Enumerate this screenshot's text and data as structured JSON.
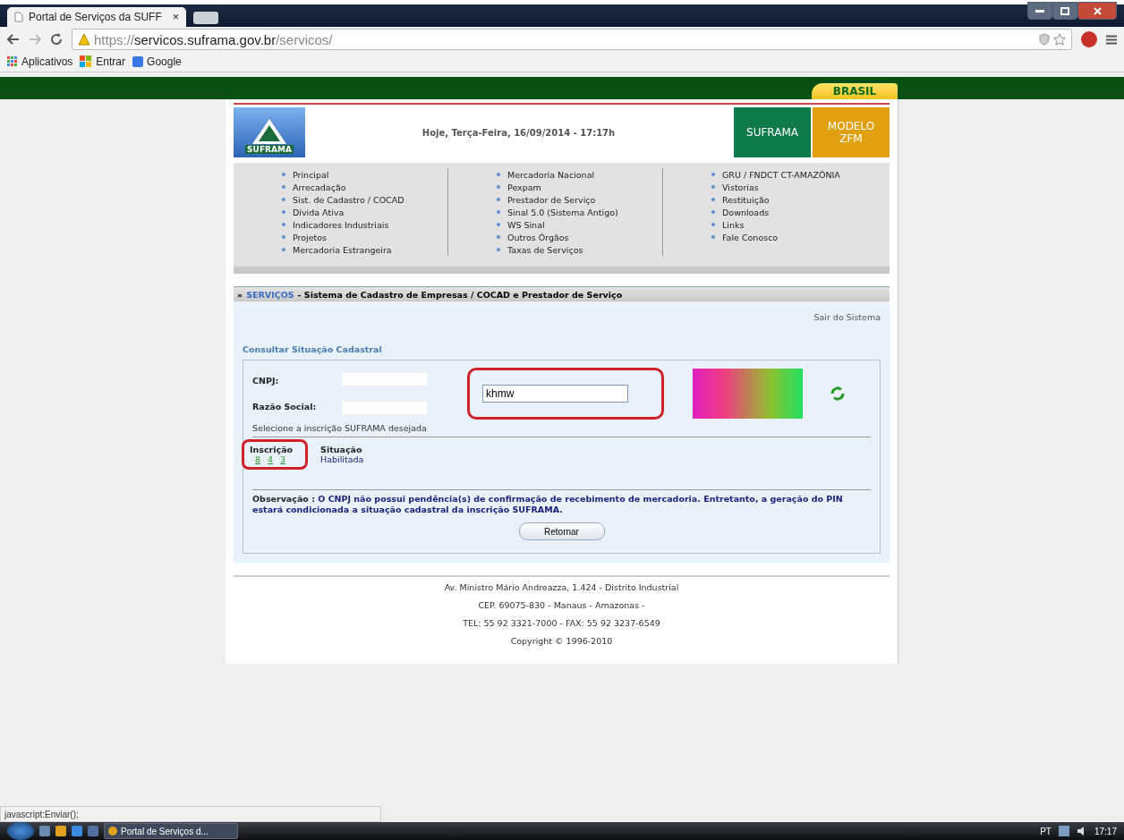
{
  "browser": {
    "tab_title": "Portal de Serviços da SUFF",
    "tab_close": "×",
    "url_scheme": "https://",
    "url_host": "servicos.suframa.gov.br",
    "url_path": "/servicos/",
    "bookmarks": [
      {
        "label": "Aplicativos",
        "kind": "apps"
      },
      {
        "label": "Entrar",
        "kind": "windows"
      },
      {
        "label": "Google",
        "kind": "google"
      }
    ],
    "status_text": "javascript:Enviar();"
  },
  "header": {
    "brasil": "BRASIL",
    "logo_text": "SUFRAMA",
    "date": "Hoje, Terça-Feira, 16/09/2014 - 17:17h",
    "buttons": [
      {
        "label": "SUFRAMA",
        "color": "#0f7a4a"
      },
      {
        "label": "MODELO ZFM",
        "color": "#e0a010"
      }
    ]
  },
  "menu": [
    [
      "Principal",
      "Arrecadação",
      "Sist. de Cadastro / COCAD",
      "Dívida Ativa",
      "Indicadores Industriais",
      "Projetos",
      "Mercadoria Estrangeira"
    ],
    [
      "Mercadoria Nacional",
      "Pexpam",
      "Prestador de Serviço",
      "Sinal 5.0 (Sistema Antigo)",
      "WS Sinal",
      "Outros Órgãos",
      "Taxas de Serviços"
    ],
    [
      "GRU / FNDCT CT-AMAZÔNIA",
      "Vistorias",
      "Restituição",
      "Downloads",
      "Links",
      "Fale Conosco"
    ]
  ],
  "breadcrumb": {
    "prefix": "»",
    "link": "SERVIÇOS",
    "title": "- Sistema de Cadastro de Empresas / COCAD e Prestador de Serviço"
  },
  "logout": "Sair do Sistema",
  "section_title": "Consultar Situação Cadastral",
  "form": {
    "cnpj_label": "CNPJ:",
    "razao_label": "Razão Social:",
    "captcha_value": "khmw",
    "select_prompt": "Selecione a inscrição SUFRAMA desejada",
    "columns": [
      "Inscrição",
      "Situação"
    ],
    "inscricao_parts": [
      "8",
      "4",
      "3"
    ],
    "situacao": "Habilitada",
    "observation_label": "Observação :",
    "observation_text": "O CNPJ não possui pendência(s) de confirmação de recebimento de mercadoria. Entretanto, a geração do PIN estará condicionada a situação cadastral da inscrição SUFRAMA.",
    "button": "Retornar"
  },
  "footer": [
    "Av. Ministro Mário Andreazza, 1.424 - Distrito Industrial",
    "CEP. 69075-830 - Manaus - Amazonas -",
    "TEL: 55 92 3321-7000 - FAX: 55 92 3237-6549",
    "Copyright © 1996-2010"
  ],
  "taskbar": {
    "task": "Portal de Serviços d...",
    "language": "PT",
    "time": "17:17"
  }
}
